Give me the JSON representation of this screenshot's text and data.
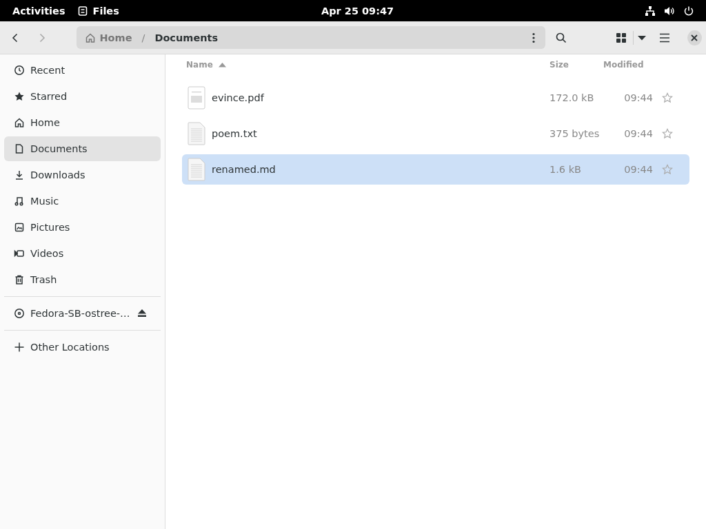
{
  "top_bar": {
    "activities": "Activities",
    "app_name": "Files",
    "clock": "Apr 25  09:47"
  },
  "path_bar": {
    "crumbs": [
      {
        "label": "Home",
        "kind": "home"
      },
      {
        "label": "Documents",
        "kind": "folder"
      }
    ],
    "separator": "/"
  },
  "sidebar": {
    "places": [
      {
        "label": "Recent",
        "kind": "recent",
        "selected": false
      },
      {
        "label": "Starred",
        "kind": "starred",
        "selected": false
      },
      {
        "label": "Home",
        "kind": "home",
        "selected": false
      },
      {
        "label": "Documents",
        "kind": "documents",
        "selected": true
      },
      {
        "label": "Downloads",
        "kind": "downloads",
        "selected": false
      },
      {
        "label": "Music",
        "kind": "music",
        "selected": false
      },
      {
        "label": "Pictures",
        "kind": "pictures",
        "selected": false
      },
      {
        "label": "Videos",
        "kind": "videos",
        "selected": false
      },
      {
        "label": "Trash",
        "kind": "trash",
        "selected": false
      }
    ],
    "devices": [
      {
        "label": "Fedora-SB-ostree-…",
        "kind": "disc",
        "selected": false
      }
    ],
    "other": [
      {
        "label": "Other Locations",
        "kind": "add",
        "selected": false
      }
    ]
  },
  "table": {
    "columns": [
      {
        "label": "Name",
        "sorted": true
      },
      {
        "label": "Size",
        "sorted": false
      },
      {
        "label": "Modified",
        "sorted": false
      }
    ],
    "rows": [
      {
        "name": "evince.pdf",
        "kind": "pdf",
        "size": "172.0 kB",
        "modified": "09:44",
        "selected": false,
        "starred": false
      },
      {
        "name": "poem.txt",
        "kind": "text",
        "size": "375 bytes",
        "modified": "09:44",
        "selected": false,
        "starred": false
      },
      {
        "name": "renamed.md",
        "kind": "text",
        "size": "1.6 kB",
        "modified": "09:44",
        "selected": true,
        "starred": false
      }
    ]
  }
}
